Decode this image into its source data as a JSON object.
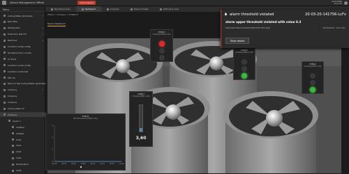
{
  "topbar": {
    "title": "Device Management Official",
    "ack_label": "One instance",
    "time_line1": "09.03.2020",
    "time_line2": "12:17:51"
  },
  "tabs": [
    {
      "label": "Monitoring tools"
    },
    {
      "label": "Dashboard"
    },
    {
      "label": "Analytics"
    },
    {
      "label": "Tasks & Tickets"
    },
    {
      "label": "Settings & rules"
    }
  ],
  "sidebar": {
    "header": "Menu",
    "items": [
      {
        "label": "Cooling Water Application",
        "level": 0,
        "caret": "▸"
      },
      {
        "label": "Main filter",
        "level": 0,
        "caret": ""
      },
      {
        "label": "Refrigeration",
        "level": 0,
        "caret": "▸"
      },
      {
        "label": "Production Hall VVI",
        "level": 0,
        "caret": "▸"
      },
      {
        "label": "Machines",
        "level": 0,
        "caret": "▸"
      },
      {
        "label": "Condition model config",
        "level": 0,
        "caret": ""
      },
      {
        "label": "Operating hours counter",
        "level": 0,
        "caret": ""
      },
      {
        "label": "Air Dryer",
        "level": 0,
        "caret": ""
      },
      {
        "label": "Condition model config",
        "level": 0,
        "caret": ""
      },
      {
        "label": "Condition model test",
        "level": 0,
        "caret": ""
      },
      {
        "label": "OPC UA",
        "level": 0,
        "caret": ""
      },
      {
        "label": "Parts for Test Cooling Water Application",
        "level": 0,
        "caret": ""
      },
      {
        "label": "Company",
        "level": 0,
        "caret": "▸"
      },
      {
        "label": "Company",
        "level": 0,
        "caret": ""
      },
      {
        "label": "Company",
        "level": 0,
        "caret": ""
      },
      {
        "label": "Cooling water Air",
        "level": 0,
        "caret": ""
      },
      {
        "label": "Company",
        "level": 0,
        "caret": "▾"
      },
      {
        "label": "sensor 1",
        "level": 1,
        "caret": ""
      },
      {
        "label": "VVI/Pack",
        "level": 2,
        "caret": ""
      },
      {
        "label": "VVI/test",
        "level": 2,
        "caret": ""
      },
      {
        "label": "VVI/2",
        "level": 2,
        "caret": ""
      },
      {
        "label": "VVI/3",
        "level": 2,
        "caret": ""
      },
      {
        "label": "VVI/4",
        "level": 2,
        "caret": ""
      },
      {
        "label": "VVI/5",
        "level": 2,
        "caret": ""
      },
      {
        "label": "Temperature",
        "level": 2,
        "caret": ""
      },
      {
        "label": "VVI/6",
        "level": 2,
        "caret": ""
      }
    ]
  },
  "breadcrumb": "IPO/LC / Company / VVI&B1/3",
  "subtab": "Device Dashboard",
  "widgets": {
    "status1": {
      "title": "VVB2/1",
      "sub": "Company/VVB1/ Lo Fan",
      "lights": [
        "red",
        "off",
        "off"
      ]
    },
    "status2": {
      "title": "VVB2/1",
      "sub": "Company/VVB1/ Lo Fan",
      "lights": [
        "off",
        "off",
        "green"
      ]
    },
    "status3": {
      "title": "VVB2/1",
      "sub": "Company/VVB1/ Lo Fan",
      "lights": [
        "off",
        "off",
        "green"
      ]
    },
    "gauge": {
      "title": "VVB2/1",
      "sub": "Company/VVB1/ Lo Fan",
      "value_text": "3,60",
      "level": 0.12
    },
    "chart_title": "VVB2/1",
    "chart_sub": "PPV AM Company/VVB/1 Lo Fan"
  },
  "chart_data": {
    "type": "line",
    "title": "VVB2/1",
    "subtitle": "PPV AM Company/VVB/1 Lo Fan",
    "x": [
      "09:20",
      "09:35",
      "09:50",
      "10:05",
      "10:20",
      "10:35",
      "10:50",
      "11:05"
    ],
    "series": [
      {
        "name": "",
        "values": [
          0,
          0,
          0,
          0,
          0,
          0,
          0,
          0
        ]
      }
    ],
    "ylim": [
      0,
      3
    ],
    "yticks": [
      "3",
      "2",
      "1",
      "0"
    ],
    "grid": false,
    "legend": "bottom"
  },
  "notification": {
    "title": "alarm threshold violated",
    "id": "20-03-20-141756-LcFv",
    "message": "alarm upper threshold violated with value 8.3",
    "meta_left": "5e67be4f-43fe-47cd-8a33-f9b33767d07c/test",
    "meta_right": "20/03/2020 - 12:17:56",
    "button": "Show details"
  },
  "colors": {
    "accent": "#c0392b",
    "green": "#3db83d",
    "tab_underline": "#e9a23b"
  }
}
